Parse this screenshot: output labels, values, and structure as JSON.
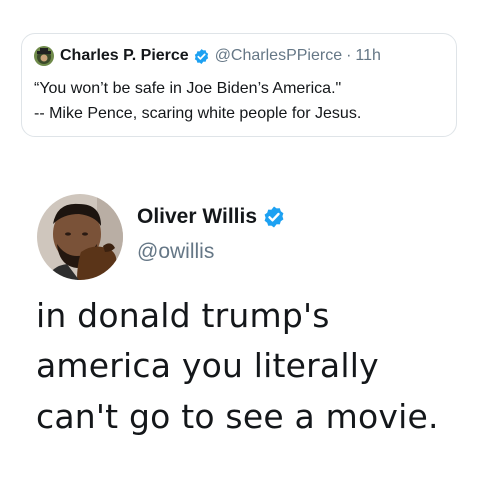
{
  "quoted_tweet": {
    "name": "Charles P. Pierce",
    "handle": "@CharlesPPierce",
    "separator": "·",
    "time": "11h",
    "text_lines": [
      "“You won’t be safe in Joe Biden’s America.\"",
      "-- Mike Pence, scaring white people for Jesus."
    ]
  },
  "tweet": {
    "name": "Oliver Willis",
    "handle": "@owillis",
    "text_lines": [
      "in donald trump's",
      "america you literally",
      "can't go to see a movie."
    ]
  },
  "colors": {
    "verified_blue": "#1da1f2",
    "secondary_text": "#657786",
    "primary_text": "#14171a",
    "card_border": "#dfe4e8"
  },
  "icons": {
    "verified": "verified-badge-icon"
  }
}
